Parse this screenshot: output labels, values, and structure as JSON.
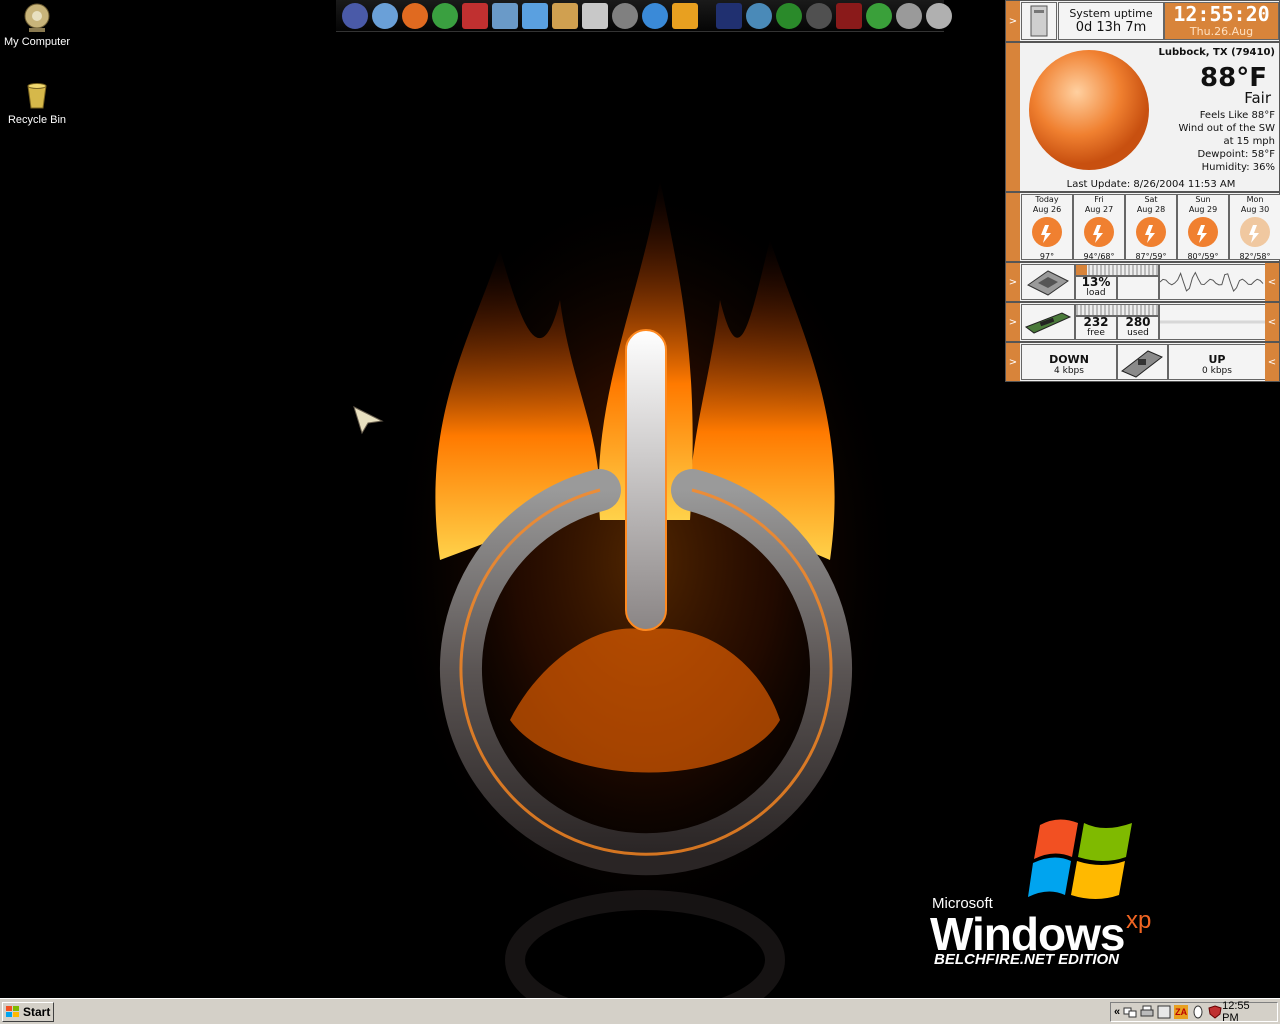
{
  "desktop": {
    "icons": [
      {
        "label": "My Computer"
      },
      {
        "label": "Recycle Bin"
      }
    ]
  },
  "branding": {
    "microsoft": "Microsoft",
    "windows": "Windows",
    "xp": "xp",
    "edition": "BELCHFIRE.NET EDITION"
  },
  "widget": {
    "uptime_label": "System uptime",
    "uptime_value": "0d 13h 7m",
    "clock_time": "12:55:20",
    "clock_date": "Thu.26.Aug",
    "weather": {
      "location": "Lubbock, TX (79410)",
      "temp": "88°F",
      "condition": "Fair",
      "feels_like": "Feels Like 88°F",
      "wind": "Wind out of the SW",
      "wind_speed": "at 15 mph",
      "dewpoint": "Dewpoint: 58°F",
      "humidity": "Humidity: 36%",
      "last_update": "Last Update: 8/26/2004 11:53 AM"
    },
    "forecast": [
      {
        "day": "Today",
        "date": "Aug 26",
        "temp": "97°"
      },
      {
        "day": "Fri",
        "date": "Aug 27",
        "temp": "94°/68°"
      },
      {
        "day": "Sat",
        "date": "Aug 28",
        "temp": "87°/59°"
      },
      {
        "day": "Sun",
        "date": "Aug 29",
        "temp": "80°/59°"
      },
      {
        "day": "Mon",
        "date": "Aug 30",
        "temp": "82°/58°"
      }
    ],
    "cpu": {
      "value": "13%",
      "label": "load",
      "load_fraction": 0.13
    },
    "memory": {
      "free": "232",
      "free_label": "free",
      "used": "280",
      "used_label": "used"
    },
    "network": {
      "down": "DOWN",
      "down_rate": "4 kbps",
      "up": "UP",
      "up_rate": "0 kbps"
    },
    "arrow_left": ">",
    "arrow_right": "<"
  },
  "taskbar": {
    "start_label": "Start",
    "tray_expand": "«",
    "za_label": "ZA",
    "clock": "12:55 PM"
  },
  "colors": {
    "accent_orange": "#d8843a",
    "flame": "#ff6a00",
    "taskbar": "#d4d0c8"
  }
}
